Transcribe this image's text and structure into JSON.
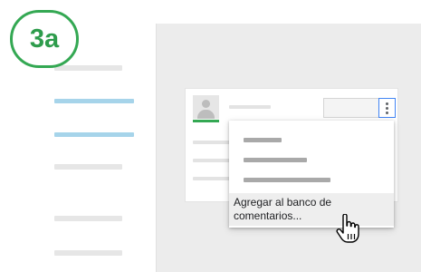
{
  "step_badge": {
    "label": "3a",
    "color": "#34a853"
  },
  "menu": {
    "highlighted_item": {
      "line1": "Agregar al banco de",
      "line2": "comentarios..."
    }
  },
  "icons": {
    "badge": "step-badge",
    "avatar": "user-avatar-icon",
    "more": "more-vert-icon",
    "cursor": "hand-pointer-icon"
  },
  "colors": {
    "accent_green": "#34a853",
    "active_nav": "#a6d4ea",
    "focus_blue": "#4285f4"
  }
}
